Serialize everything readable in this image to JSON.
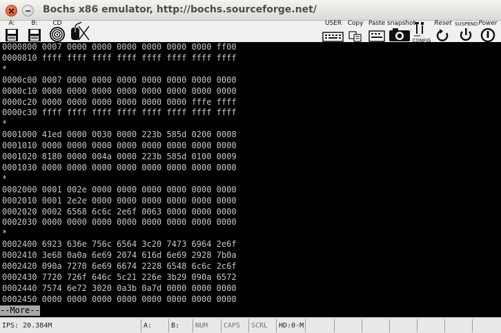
{
  "window": {
    "title": "Bochs x86 emulator, http://bochs.sourceforge.net/"
  },
  "toolbar": {
    "floppy_a": "A:",
    "floppy_b": "B:",
    "cdrom": "CD",
    "user": "USER",
    "copy": "Copy",
    "paste": "Paste",
    "snapshot": "snapshot",
    "config": "CONFIG",
    "reset": "Reset",
    "suspend": "SUSPEND",
    "power": "Power"
  },
  "terminal": {
    "lines": [
      "0000800 0007 0000 0000 0000 0000 0000 0000 ff00",
      "0000810 ffff ffff ffff ffff ffff ffff ffff ffff",
      "*",
      "0000c00 0007 0000 0000 0000 0000 0000 0000 0000",
      "0000c10 0000 0000 0000 0000 0000 0000 0000 0000",
      "0000c20 0000 0000 0000 0000 0000 0000 fffe ffff",
      "0000c30 ffff ffff ffff ffff ffff ffff ffff ffff",
      "*",
      "0001000 41ed 0000 0030 0000 223b 585d 0200 0008",
      "0001010 0000 0000 0000 0000 0000 0000 0000 0000",
      "0001020 8180 0000 004a 0000 223b 585d 0100 0009",
      "0001030 0000 0000 0000 0000 0000 0000 0000 0000",
      "*",
      "0002000 0001 002e 0000 0000 0000 0000 0000 0000",
      "0002010 0001 2e2e 0000 0000 0000 0000 0000 0000",
      "0002020 0002 6568 6c6c 2e6f 0063 0000 0000 0000",
      "0002030 0000 0000 0000 0000 0000 0000 0000 0000",
      "*",
      "0002400 6923 636e 756c 6564 3c20 7473 6964 2e6f",
      "0002410 3e68 0a0a 6e69 2074 616d 6e69 2928 7b0a",
      "0002420 090a 7270 6e69 6674 2228 6548 6c6c 2c6f",
      "0002430 7720 726f 646c 5c21 226e 3b29 090a 6572",
      "0002440 7574 6e72 3020 0a3b 0a7d 0000 0000 0000",
      "0002450 0000 0000 0000 0000 0000 0000 0000 0000"
    ],
    "pager": "--More--"
  },
  "statusbar": {
    "ips": "IPS: 20.384M",
    "floppy_a": "A:",
    "floppy_b": "B:",
    "num": "NUM",
    "caps": "CAPS",
    "scrl": "SCRL",
    "hd": "HD:0-M"
  }
}
